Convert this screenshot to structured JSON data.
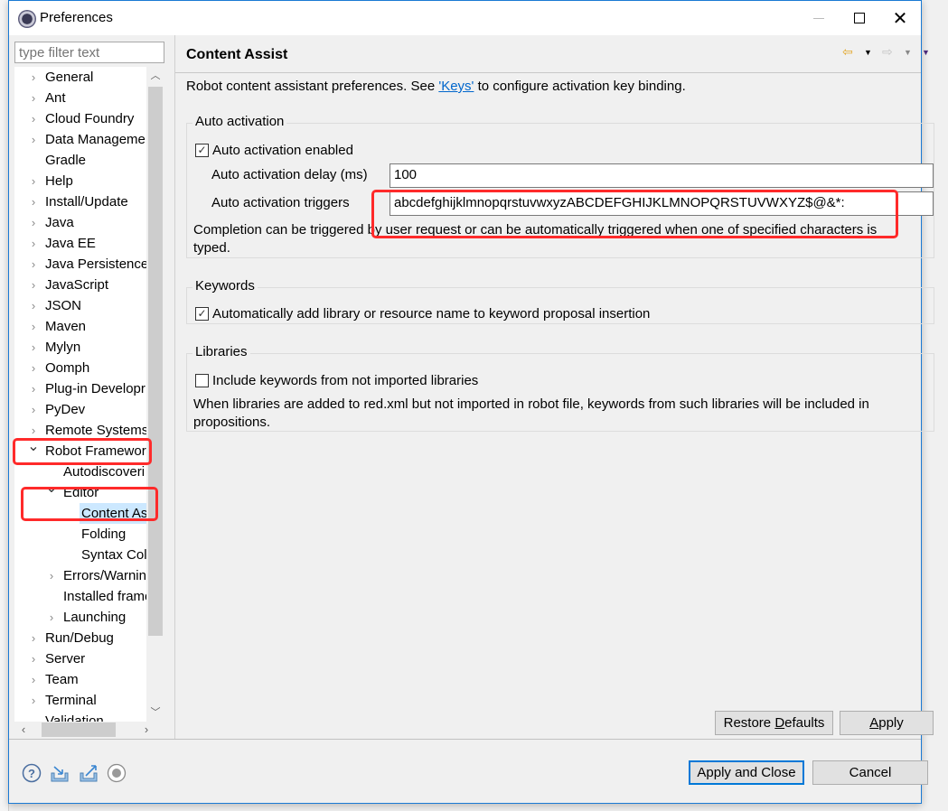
{
  "window": {
    "title": "Preferences",
    "controls": [
      "minimize",
      "maximize",
      "close"
    ]
  },
  "sidebar": {
    "filter_placeholder": "type filter text",
    "items": [
      {
        "label": "General",
        "level": 0,
        "expandable": true,
        "expanded": false
      },
      {
        "label": "Ant",
        "level": 0,
        "expandable": true,
        "expanded": false
      },
      {
        "label": "Cloud Foundry",
        "level": 0,
        "expandable": true,
        "expanded": false
      },
      {
        "label": "Data Manageme",
        "level": 0,
        "expandable": true,
        "expanded": false
      },
      {
        "label": "Gradle",
        "level": 0,
        "expandable": false
      },
      {
        "label": "Help",
        "level": 0,
        "expandable": true,
        "expanded": false
      },
      {
        "label": "Install/Update",
        "level": 0,
        "expandable": true,
        "expanded": false
      },
      {
        "label": "Java",
        "level": 0,
        "expandable": true,
        "expanded": false
      },
      {
        "label": "Java EE",
        "level": 0,
        "expandable": true,
        "expanded": false
      },
      {
        "label": "Java Persistence",
        "level": 0,
        "expandable": true,
        "expanded": false
      },
      {
        "label": "JavaScript",
        "level": 0,
        "expandable": true,
        "expanded": false
      },
      {
        "label": "JSON",
        "level": 0,
        "expandable": true,
        "expanded": false
      },
      {
        "label": "Maven",
        "level": 0,
        "expandable": true,
        "expanded": false
      },
      {
        "label": "Mylyn",
        "level": 0,
        "expandable": true,
        "expanded": false
      },
      {
        "label": "Oomph",
        "level": 0,
        "expandable": true,
        "expanded": false
      },
      {
        "label": "Plug-in Developr",
        "level": 0,
        "expandable": true,
        "expanded": false
      },
      {
        "label": "PyDev",
        "level": 0,
        "expandable": true,
        "expanded": false
      },
      {
        "label": "Remote Systems",
        "level": 0,
        "expandable": true,
        "expanded": false
      },
      {
        "label": "Robot Framewor",
        "level": 0,
        "expandable": true,
        "expanded": true
      },
      {
        "label": "Autodiscoveri",
        "level": 1,
        "expandable": false
      },
      {
        "label": "Editor",
        "level": 1,
        "expandable": true,
        "expanded": true
      },
      {
        "label": "Content As",
        "level": 2,
        "expandable": false,
        "selected": true
      },
      {
        "label": "Folding",
        "level": 2,
        "expandable": false
      },
      {
        "label": "Syntax Colo",
        "level": 2,
        "expandable": false
      },
      {
        "label": "Errors/Warnin",
        "level": 1,
        "expandable": true,
        "expanded": false
      },
      {
        "label": "Installed frame",
        "level": 1,
        "expandable": false
      },
      {
        "label": "Launching",
        "level": 1,
        "expandable": true,
        "expanded": false
      },
      {
        "label": "Run/Debug",
        "level": 0,
        "expandable": true,
        "expanded": false
      },
      {
        "label": "Server",
        "level": 0,
        "expandable": true,
        "expanded": false
      },
      {
        "label": "Team",
        "level": 0,
        "expandable": true,
        "expanded": false
      },
      {
        "label": "Terminal",
        "level": 0,
        "expandable": true,
        "expanded": false
      },
      {
        "label": "Validation",
        "level": 0,
        "expandable": false
      }
    ]
  },
  "page": {
    "title": "Content Assist",
    "description_before": "Robot content assistant preferences. See ",
    "description_link": "'Keys'",
    "description_after": " to configure activation key binding.",
    "groups": {
      "auto_activation": {
        "title": "Auto activation",
        "enabled_label": "Auto activation enabled",
        "enabled_checked": true,
        "delay_label": "Auto activation delay (ms)",
        "delay_value": "100",
        "triggers_label": "Auto activation triggers",
        "triggers_value": "abcdefghijklmnopqrstuvwxyzABCDEFGHIJKLMNOPQRSTUVWXYZ$@&*:",
        "note": "Completion can be triggered by user request or can be automatically triggered when one of specified characters is typed."
      },
      "keywords": {
        "title": "Keywords",
        "auto_add_label": "Automatically add library or resource name to keyword proposal insertion",
        "auto_add_checked": true
      },
      "libraries": {
        "title": "Libraries",
        "include_label": "Include keywords from not imported libraries",
        "include_checked": false,
        "note": "When libraries are added to red.xml but not imported in robot file, keywords from such libraries will be included in propositions."
      }
    },
    "buttons": {
      "restore_defaults_pre": "Restore ",
      "restore_defaults_mn": "D",
      "restore_defaults_post": "efaults",
      "apply_mn": "A",
      "apply_post": "pply"
    }
  },
  "footer": {
    "apply_close": "Apply and Close",
    "cancel": "Cancel",
    "icons": [
      "help-icon",
      "import-icon",
      "export-icon",
      "record-icon"
    ]
  },
  "colors": {
    "accent": "#0078d7",
    "link": "#0066cc",
    "selection": "#cce8ff",
    "annotation": "#ff2a2a"
  }
}
